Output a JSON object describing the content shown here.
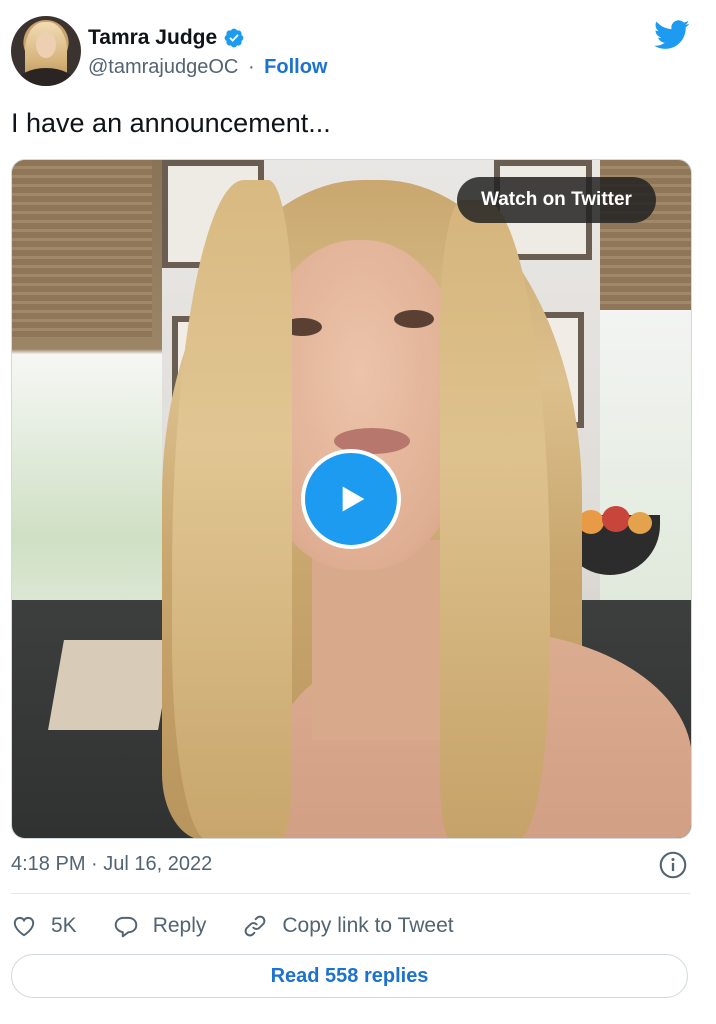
{
  "author": {
    "name": "Tamra Judge",
    "handle": "@tamrajudgeOC",
    "separator": "·",
    "follow_label": "Follow",
    "verified_icon": "verified-badge-icon",
    "avatar_icon": "profile-photo"
  },
  "brand": {
    "logo_icon": "twitter-bird-icon",
    "color": "#1d9bf0"
  },
  "tweet": {
    "text": "I have an announcement...",
    "timestamp": "4:18 PM · Jul 16, 2022"
  },
  "video": {
    "watch_label": "Watch on Twitter",
    "play_icon": "play-icon"
  },
  "actions": {
    "like_count": "5K",
    "reply_label": "Reply",
    "copy_link_label": "Copy link to Tweet"
  },
  "footer": {
    "read_replies_label": "Read 558 replies",
    "link_color": "#1d72cf"
  }
}
